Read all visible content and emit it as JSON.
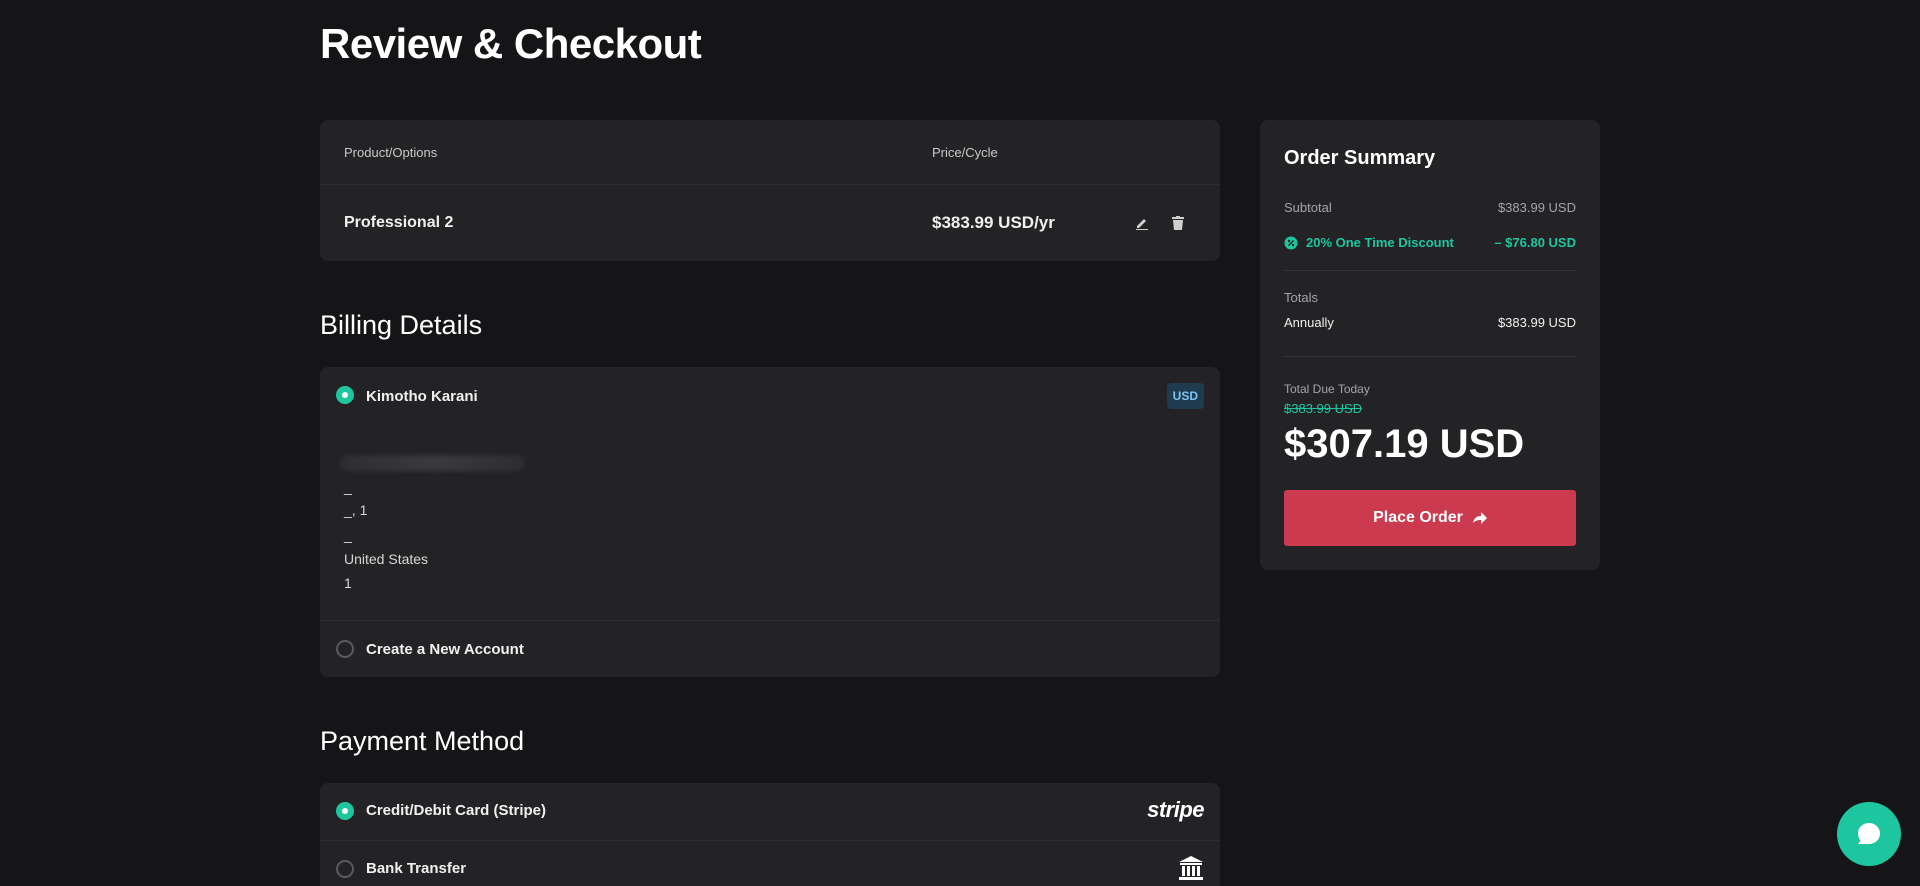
{
  "page": {
    "title": "Review & Checkout"
  },
  "cart": {
    "headers": {
      "product": "Product/Options",
      "price": "Price/Cycle"
    },
    "items": [
      {
        "name": "Professional 2",
        "price": "$383.99 USD/yr",
        "edit_icon": "pencil-icon",
        "delete_icon": "trash-icon"
      }
    ]
  },
  "billing": {
    "title": "Billing Details",
    "account": {
      "name": "Kimotho Karani",
      "currency": "USD",
      "address_lines": [
        "_",
        "_, 1",
        "_",
        "United States",
        "1"
      ]
    },
    "new_account_label": "Create a New Account"
  },
  "payment": {
    "title": "Payment Method",
    "methods": [
      {
        "label": "Credit/Debit Card (Stripe)",
        "logo": "stripe",
        "selected": true
      },
      {
        "label": "Bank Transfer",
        "icon": "bank-icon",
        "selected": false
      }
    ]
  },
  "summary": {
    "title": "Order Summary",
    "subtotal_label": "Subtotal",
    "subtotal_value": "$383.99 USD",
    "discount_label": "20% One Time Discount",
    "discount_value": "– $76.80 USD",
    "totals_label": "Totals",
    "annually_label": "Annually",
    "annually_value": "$383.99 USD",
    "total_due_label": "Total Due Today",
    "total_old": "$383.99 USD",
    "total_amount": "$307.19 USD",
    "place_order_label": "Place Order"
  },
  "colors": {
    "accent": "#1ec6a0",
    "danger": "#cc3a4f",
    "background": "#151517",
    "card": "#232325"
  }
}
